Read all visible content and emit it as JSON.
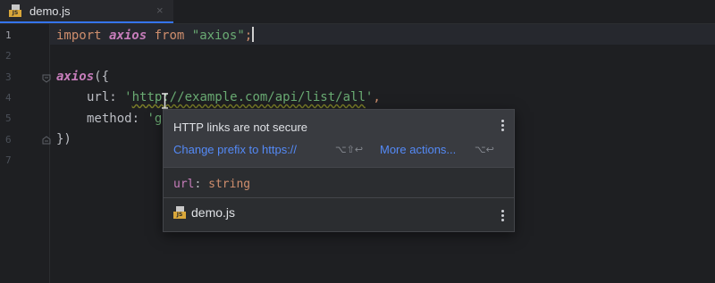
{
  "tab": {
    "icon": "js-file-icon",
    "badge": "JS",
    "label": "demo.js",
    "close": "×"
  },
  "gutter": {
    "lines": [
      "1",
      "2",
      "3",
      "4",
      "5",
      "6",
      "7"
    ]
  },
  "code": {
    "line1": {
      "kw_import": "import",
      "axios": "axios",
      "kw_from": "from",
      "module": "\"axios\"",
      "end": ";"
    },
    "line3": {
      "fn": "axios",
      "open": "({"
    },
    "line4": {
      "key": "url",
      "colon": ": ",
      "quote_open": "'",
      "url": "http://example.com/api/list/all",
      "quote_close": "'",
      "comma": ","
    },
    "line5": {
      "key": "method",
      "colon": ": ",
      "partial": "'g"
    },
    "line6": {
      "close": "})"
    }
  },
  "popup": {
    "title": "HTTP links are not secure",
    "action_primary": "Change prefix to https://",
    "action_primary_shortcut": "⌥⇧↩",
    "action_more": "More actions...",
    "action_more_shortcut": "⌥↩",
    "type_name": "url",
    "type_colon": ": ",
    "type_value": "string",
    "file_label": "demo.js",
    "file_badge": "JS"
  },
  "colors": {
    "background": "#1e1f22",
    "accent": "#3574f0",
    "link": "#548af7",
    "keyword": "#cf8e6d",
    "identifier": "#c77dbb",
    "string": "#6aab73"
  }
}
